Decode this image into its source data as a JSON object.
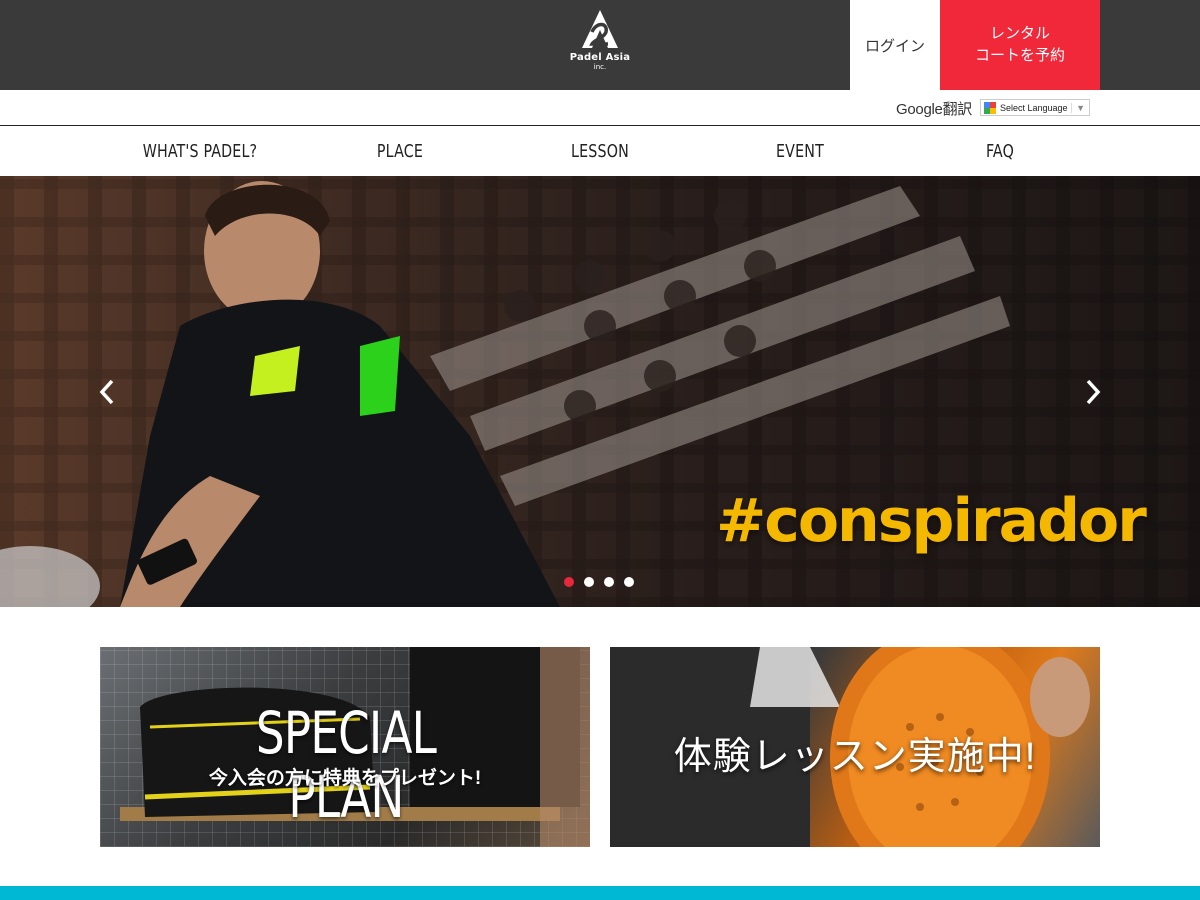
{
  "header": {
    "logo_name": "Padel Asia",
    "logo_sub": "inc.",
    "login_label": "ログイン",
    "rental_label_line1": "レンタル",
    "rental_label_line2": "コートを予約"
  },
  "translate": {
    "google_label": "Google翻訳",
    "select_label": "Select Language",
    "caret": "▼"
  },
  "nav": {
    "items": [
      {
        "label": "WHAT'S PADEL?"
      },
      {
        "label": "PLACE"
      },
      {
        "label": "LESSON"
      },
      {
        "label": "EVENT"
      },
      {
        "label": "FAQ"
      }
    ]
  },
  "hero": {
    "caption": "#conspirador",
    "prev_icon": "chevron-left-icon",
    "next_icon": "chevron-right-icon",
    "slide_count": 4,
    "active_slide": 1
  },
  "banners": {
    "special_plan_title": "SPECIAL PLAN",
    "special_plan_sub": "今入会の方に特典をプレゼント!",
    "trial_lesson": "体験レッスン実施中!"
  },
  "colors": {
    "header_bg": "#3a3a3a",
    "accent_red": "#f0283a",
    "strip_cyan": "#00b7d4",
    "caption_yellow": "#f4b800"
  }
}
